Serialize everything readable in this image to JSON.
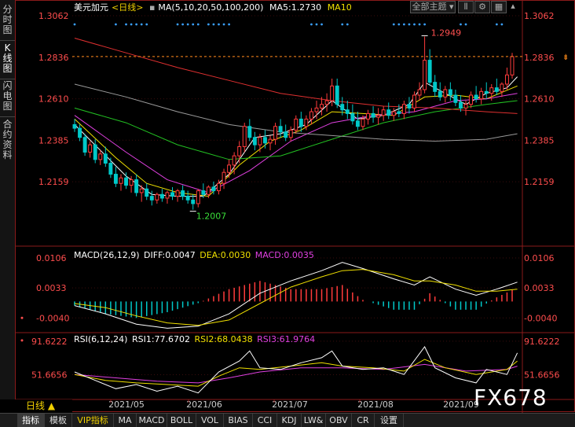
{
  "instrument": {
    "name": "美元加元",
    "period_label": "<日线>",
    "ma_label": "MA(5,10,20,50,100,200)",
    "ma5_label": "MA5:1.2730",
    "ma10_label": "MA10"
  },
  "side_tabs": [
    {
      "label": [
        "分",
        "时",
        "图"
      ],
      "active": false
    },
    {
      "label": [
        "K",
        "线",
        "图"
      ],
      "active": true
    },
    {
      "label": [
        "闪",
        "电",
        "图"
      ],
      "active": false
    },
    {
      "label": [
        "合",
        "约",
        "资",
        "料"
      ],
      "active": false
    }
  ],
  "top_buttons": {
    "theme": "全部主题",
    "chart_type_icon": "candle-icon",
    "settings_icon": "gear-icon",
    "more_icon": "grid-icon"
  },
  "price_axis": {
    "ticks": [
      "1.3062",
      "1.2836",
      "1.2610",
      "1.2385",
      "1.2159"
    ],
    "high_label": "1.2949",
    "low_label": "1.2007"
  },
  "macd": {
    "title": "MACD(26,12,9)",
    "diff": "DIFF:0.0047",
    "dea": "DEA:0.0030",
    "macd": "MACD:0.0035",
    "ticks": [
      "0.0106",
      "0.0033",
      "-0.0040"
    ]
  },
  "rsi": {
    "title": "RSI(6,12,24)",
    "rsi1": "RSI1:77.6702",
    "rsi2": "RSI2:68.0438",
    "rsi3": "RSI3:61.9764",
    "ticks": [
      "91.6222",
      "51.6656"
    ]
  },
  "x_axis": {
    "dates": [
      "2021/05",
      "2021/06",
      "2021/07",
      "2021/08",
      "2021/09"
    ]
  },
  "period_selector": "日线 ▲",
  "bottom_tabs": [
    {
      "label": "指标",
      "active": true,
      "vip": false
    },
    {
      "label": "模板",
      "active": false,
      "vip": false
    },
    {
      "label": "VIP指标",
      "active": false,
      "vip": true
    },
    {
      "label": "MA",
      "active": false,
      "vip": false
    },
    {
      "label": "MACD",
      "active": false,
      "vip": false
    },
    {
      "label": "BOLL",
      "active": false,
      "vip": false
    },
    {
      "label": "VOL",
      "active": false,
      "vip": false
    },
    {
      "label": "BIAS",
      "active": false,
      "vip": false
    },
    {
      "label": "CCI",
      "active": false,
      "vip": false
    },
    {
      "label": "KDJ",
      "active": false,
      "vip": false
    },
    {
      "label": "LW&",
      "active": false,
      "vip": false
    },
    {
      "label": "OBV",
      "active": false,
      "vip": false
    },
    {
      "label": "CR",
      "active": false,
      "vip": false
    },
    {
      "label": "设置",
      "active": false,
      "vip": false
    }
  ],
  "watermark": "FX678",
  "colors": {
    "up": "#ff3b3b",
    "down": "#00c9c9",
    "ma5": "#ffffff",
    "ma10": "#f0e000",
    "ma20": "#e040e0",
    "ma50": "#22c022",
    "ma100": "#9a9a9a",
    "ma200": "#e03030",
    "axis": "#ff4d4d",
    "grid": "#8a1a1a"
  },
  "chart_data": {
    "type": "candlestick",
    "price_range": [
      1.195,
      1.3062
    ],
    "candles": [
      [
        1.247,
        1.25,
        1.243,
        1.245
      ],
      [
        1.245,
        1.247,
        1.238,
        1.24
      ],
      [
        1.24,
        1.242,
        1.23,
        1.232
      ],
      [
        1.232,
        1.238,
        1.229,
        1.236
      ],
      [
        1.236,
        1.239,
        1.226,
        1.228
      ],
      [
        1.228,
        1.233,
        1.225,
        1.231
      ],
      [
        1.231,
        1.235,
        1.224,
        1.226
      ],
      [
        1.226,
        1.229,
        1.218,
        1.22
      ],
      [
        1.22,
        1.224,
        1.213,
        1.215
      ],
      [
        1.215,
        1.22,
        1.211,
        1.218
      ],
      [
        1.218,
        1.221,
        1.212,
        1.214
      ],
      [
        1.214,
        1.219,
        1.21,
        1.217
      ],
      [
        1.217,
        1.22,
        1.208,
        1.21
      ],
      [
        1.21,
        1.214,
        1.205,
        1.212
      ],
      [
        1.212,
        1.215,
        1.206,
        1.208
      ],
      [
        1.208,
        1.211,
        1.203,
        1.206
      ],
      [
        1.206,
        1.21,
        1.204,
        1.209
      ],
      [
        1.209,
        1.212,
        1.205,
        1.207
      ],
      [
        1.207,
        1.211,
        1.204,
        1.21
      ],
      [
        1.21,
        1.213,
        1.206,
        1.208
      ],
      [
        1.208,
        1.212,
        1.205,
        1.211
      ],
      [
        1.211,
        1.214,
        1.206,
        1.208
      ],
      [
        1.208,
        1.211,
        1.204,
        1.206
      ],
      [
        1.206,
        1.209,
        1.2007,
        1.204
      ],
      [
        1.204,
        1.212,
        1.202,
        1.211
      ],
      [
        1.211,
        1.215,
        1.207,
        1.209
      ],
      [
        1.209,
        1.214,
        1.207,
        1.213
      ],
      [
        1.213,
        1.216,
        1.209,
        1.211
      ],
      [
        1.211,
        1.217,
        1.209,
        1.215
      ],
      [
        1.215,
        1.223,
        1.212,
        1.221
      ],
      [
        1.221,
        1.228,
        1.218,
        1.225
      ],
      [
        1.225,
        1.232,
        1.22,
        1.23
      ],
      [
        1.23,
        1.238,
        1.226,
        1.235
      ],
      [
        1.235,
        1.248,
        1.232,
        1.246
      ],
      [
        1.246,
        1.25,
        1.238,
        1.24
      ],
      [
        1.24,
        1.243,
        1.233,
        1.236
      ],
      [
        1.236,
        1.242,
        1.232,
        1.24
      ],
      [
        1.24,
        1.244,
        1.234,
        1.237
      ],
      [
        1.237,
        1.241,
        1.233,
        1.239
      ],
      [
        1.239,
        1.248,
        1.236,
        1.246
      ],
      [
        1.246,
        1.25,
        1.24,
        1.243
      ],
      [
        1.243,
        1.247,
        1.238,
        1.24
      ],
      [
        1.24,
        1.246,
        1.238,
        1.244
      ],
      [
        1.244,
        1.252,
        1.242,
        1.25
      ],
      [
        1.25,
        1.254,
        1.243,
        1.246
      ],
      [
        1.246,
        1.252,
        1.244,
        1.25
      ],
      [
        1.25,
        1.256,
        1.247,
        1.254
      ],
      [
        1.254,
        1.26,
        1.25,
        1.256
      ],
      [
        1.256,
        1.262,
        1.252,
        1.258
      ],
      [
        1.258,
        1.264,
        1.254,
        1.26
      ],
      [
        1.26,
        1.272,
        1.257,
        1.268
      ],
      [
        1.268,
        1.272,
        1.256,
        1.258
      ],
      [
        1.258,
        1.262,
        1.252,
        1.255
      ],
      [
        1.255,
        1.26,
        1.25,
        1.253
      ],
      [
        1.253,
        1.258,
        1.247,
        1.249
      ],
      [
        1.249,
        1.254,
        1.244,
        1.246
      ],
      [
        1.246,
        1.252,
        1.244,
        1.25
      ],
      [
        1.25,
        1.255,
        1.247,
        1.253
      ],
      [
        1.253,
        1.257,
        1.248,
        1.251
      ],
      [
        1.251,
        1.256,
        1.247,
        1.252
      ],
      [
        1.252,
        1.257,
        1.249,
        1.255
      ],
      [
        1.255,
        1.259,
        1.25,
        1.252
      ],
      [
        1.252,
        1.256,
        1.249,
        1.254
      ],
      [
        1.254,
        1.258,
        1.251,
        1.253
      ],
      [
        1.253,
        1.26,
        1.25,
        1.258
      ],
      [
        1.258,
        1.262,
        1.253,
        1.256
      ],
      [
        1.256,
        1.265,
        1.254,
        1.263
      ],
      [
        1.263,
        1.27,
        1.26,
        1.266
      ],
      [
        1.266,
        1.2949,
        1.264,
        1.282
      ],
      [
        1.282,
        1.288,
        1.268,
        1.27
      ],
      [
        1.27,
        1.274,
        1.262,
        1.265
      ],
      [
        1.265,
        1.27,
        1.26,
        1.262
      ],
      [
        1.262,
        1.268,
        1.259,
        1.266
      ],
      [
        1.266,
        1.27,
        1.26,
        1.263
      ],
      [
        1.263,
        1.266,
        1.257,
        1.259
      ],
      [
        1.259,
        1.263,
        1.254,
        1.256
      ],
      [
        1.256,
        1.26,
        1.252,
        1.258
      ],
      [
        1.258,
        1.265,
        1.256,
        1.263
      ],
      [
        1.263,
        1.268,
        1.259,
        1.261
      ],
      [
        1.261,
        1.267,
        1.258,
        1.265
      ],
      [
        1.265,
        1.27,
        1.261,
        1.264
      ],
      [
        1.264,
        1.269,
        1.26,
        1.267
      ],
      [
        1.267,
        1.272,
        1.263,
        1.265
      ],
      [
        1.265,
        1.27,
        1.262,
        1.269
      ],
      [
        1.269,
        1.278,
        1.266,
        1.274
      ],
      [
        1.274,
        1.286,
        1.272,
        1.284
      ]
    ],
    "ma": [
      {
        "name": "MA5",
        "color_key": "ma5",
        "values": [
          [
            0,
            1.247
          ],
          [
            5,
            1.233
          ],
          [
            10,
            1.219
          ],
          [
            15,
            1.209
          ],
          [
            20,
            1.208
          ],
          [
            25,
            1.208
          ],
          [
            30,
            1.22
          ],
          [
            35,
            1.24
          ],
          [
            40,
            1.242
          ],
          [
            45,
            1.247
          ],
          [
            50,
            1.26
          ],
          [
            55,
            1.25
          ],
          [
            60,
            1.252
          ],
          [
            65,
            1.258
          ],
          [
            68,
            1.27
          ],
          [
            72,
            1.264
          ],
          [
            76,
            1.258
          ],
          [
            80,
            1.264
          ],
          [
            84,
            1.267
          ],
          [
            86,
            1.273
          ]
        ]
      },
      {
        "name": "MA10",
        "color_key": "ma10",
        "values": [
          [
            0,
            1.25
          ],
          [
            8,
            1.229
          ],
          [
            14,
            1.215
          ],
          [
            20,
            1.21
          ],
          [
            26,
            1.208
          ],
          [
            32,
            1.225
          ],
          [
            38,
            1.238
          ],
          [
            44,
            1.244
          ],
          [
            50,
            1.254
          ],
          [
            56,
            1.253
          ],
          [
            62,
            1.252
          ],
          [
            68,
            1.262
          ],
          [
            74,
            1.263
          ],
          [
            80,
            1.261
          ],
          [
            86,
            1.268
          ]
        ]
      },
      {
        "name": "MA20",
        "color_key": "ma20",
        "values": [
          [
            0,
            1.252
          ],
          [
            10,
            1.232
          ],
          [
            18,
            1.217
          ],
          [
            26,
            1.21
          ],
          [
            34,
            1.222
          ],
          [
            42,
            1.238
          ],
          [
            50,
            1.248
          ],
          [
            58,
            1.252
          ],
          [
            66,
            1.254
          ],
          [
            74,
            1.26
          ],
          [
            80,
            1.261
          ],
          [
            86,
            1.264
          ]
        ]
      },
      {
        "name": "MA50",
        "color_key": "ma50",
        "values": [
          [
            0,
            1.256
          ],
          [
            10,
            1.248
          ],
          [
            20,
            1.236
          ],
          [
            30,
            1.228
          ],
          [
            40,
            1.23
          ],
          [
            50,
            1.239
          ],
          [
            60,
            1.248
          ],
          [
            70,
            1.254
          ],
          [
            80,
            1.258
          ],
          [
            86,
            1.26
          ]
        ]
      },
      {
        "name": "MA100",
        "color_key": "ma100",
        "values": [
          [
            0,
            1.269
          ],
          [
            10,
            1.262
          ],
          [
            20,
            1.254
          ],
          [
            30,
            1.247
          ],
          [
            40,
            1.243
          ],
          [
            50,
            1.241
          ],
          [
            60,
            1.239
          ],
          [
            70,
            1.238
          ],
          [
            80,
            1.239
          ],
          [
            86,
            1.242
          ]
        ]
      },
      {
        "name": "MA200",
        "color_key": "ma200",
        "values": [
          [
            0,
            1.294
          ],
          [
            10,
            1.286
          ],
          [
            20,
            1.278
          ],
          [
            30,
            1.271
          ],
          [
            40,
            1.264
          ],
          [
            50,
            1.26
          ],
          [
            60,
            1.257
          ],
          [
            70,
            1.256
          ],
          [
            80,
            1.254
          ],
          [
            86,
            1.253
          ]
        ]
      }
    ],
    "macd": {
      "range": [
        -0.007,
        0.0125
      ],
      "diff": [
        [
          0,
          -0.001
        ],
        [
          6,
          -0.003
        ],
        [
          12,
          -0.0055
        ],
        [
          18,
          -0.0065
        ],
        [
          24,
          -0.006
        ],
        [
          30,
          -0.003
        ],
        [
          36,
          0.002
        ],
        [
          42,
          0.005
        ],
        [
          48,
          0.0075
        ],
        [
          52,
          0.0095
        ],
        [
          56,
          0.008
        ],
        [
          62,
          0.0055
        ],
        [
          66,
          0.004
        ],
        [
          69,
          0.006
        ],
        [
          74,
          0.003
        ],
        [
          78,
          0.0015
        ],
        [
          82,
          0.003
        ],
        [
          86,
          0.0047
        ]
      ],
      "dea": [
        [
          0,
          -0.0005
        ],
        [
          6,
          -0.0015
        ],
        [
          12,
          -0.0035
        ],
        [
          18,
          -0.0052
        ],
        [
          24,
          -0.0058
        ],
        [
          30,
          -0.0045
        ],
        [
          36,
          -0.0005
        ],
        [
          42,
          0.0035
        ],
        [
          48,
          0.006
        ],
        [
          52,
          0.0075
        ],
        [
          56,
          0.0078
        ],
        [
          62,
          0.0065
        ],
        [
          66,
          0.005
        ],
        [
          69,
          0.005
        ],
        [
          74,
          0.004
        ],
        [
          78,
          0.0025
        ],
        [
          82,
          0.0025
        ],
        [
          86,
          0.003
        ]
      ]
    },
    "rsi": {
      "range": [
        25,
        100
      ],
      "rsi1": [
        [
          0,
          55
        ],
        [
          4,
          45
        ],
        [
          8,
          35
        ],
        [
          12,
          40
        ],
        [
          16,
          32
        ],
        [
          20,
          38
        ],
        [
          24,
          30
        ],
        [
          28,
          55
        ],
        [
          32,
          68
        ],
        [
          34,
          80
        ],
        [
          36,
          60
        ],
        [
          40,
          58
        ],
        [
          44,
          66
        ],
        [
          48,
          72
        ],
        [
          50,
          80
        ],
        [
          52,
          62
        ],
        [
          56,
          58
        ],
        [
          60,
          60
        ],
        [
          64,
          52
        ],
        [
          68,
          85
        ],
        [
          70,
          60
        ],
        [
          74,
          48
        ],
        [
          78,
          42
        ],
        [
          80,
          58
        ],
        [
          84,
          52
        ],
        [
          86,
          77.67
        ]
      ],
      "rsi2": [
        [
          0,
          52
        ],
        [
          6,
          45
        ],
        [
          12,
          42
        ],
        [
          18,
          40
        ],
        [
          24,
          38
        ],
        [
          28,
          50
        ],
        [
          32,
          60
        ],
        [
          36,
          58
        ],
        [
          42,
          62
        ],
        [
          48,
          66
        ],
        [
          52,
          62
        ],
        [
          58,
          60
        ],
        [
          64,
          56
        ],
        [
          68,
          70
        ],
        [
          72,
          60
        ],
        [
          78,
          52
        ],
        [
          84,
          58
        ],
        [
          86,
          68.04
        ]
      ],
      "rsi3": [
        [
          0,
          52
        ],
        [
          8,
          48
        ],
        [
          16,
          44
        ],
        [
          24,
          42
        ],
        [
          30,
          48
        ],
        [
          36,
          55
        ],
        [
          44,
          60
        ],
        [
          52,
          60
        ],
        [
          60,
          58
        ],
        [
          68,
          64
        ],
        [
          76,
          56
        ],
        [
          84,
          58
        ],
        [
          86,
          61.98
        ]
      ]
    }
  }
}
